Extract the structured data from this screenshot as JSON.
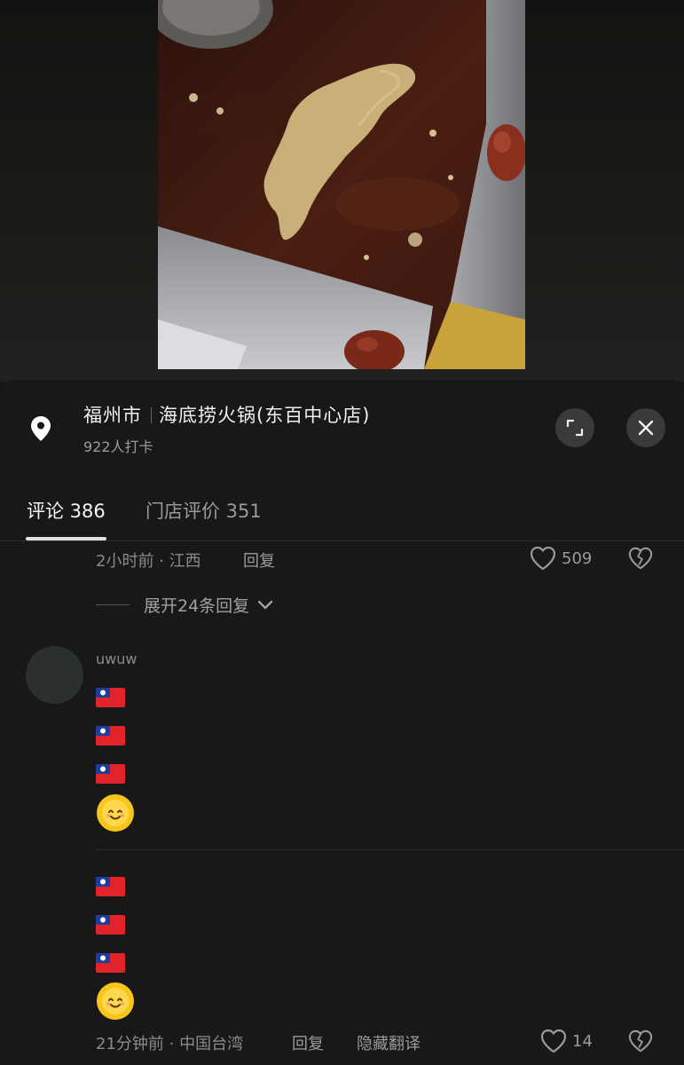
{
  "location": {
    "city": "福州市",
    "store": "海底捞火锅(东百中心店)",
    "checkins": "922人打卡"
  },
  "tabs": {
    "comments": "评论 386",
    "reviews": "门店评价 351"
  },
  "comment1": {
    "meta": "2小时前 · 江西",
    "reply": "回复",
    "likes": "509",
    "expand": "展开24条回复"
  },
  "comment2": {
    "username": "uwuw",
    "meta": "21分钟前 · 中国台湾",
    "reply": "回复",
    "hide_translation": "隐藏翻译",
    "likes": "14"
  },
  "icons": {
    "location": "location-pin-icon",
    "expand": "expand-icon",
    "close": "close-icon",
    "like": "heart-icon",
    "dislike": "broken-heart-icon",
    "chevron": "chevron-down-icon",
    "flag": "flag-emoji",
    "sun": "smiling-sun-emoji"
  },
  "colors": {
    "sheet_bg": "#181818",
    "text_primary": "#f0f0f0",
    "text_secondary": "#9a9a9a"
  }
}
